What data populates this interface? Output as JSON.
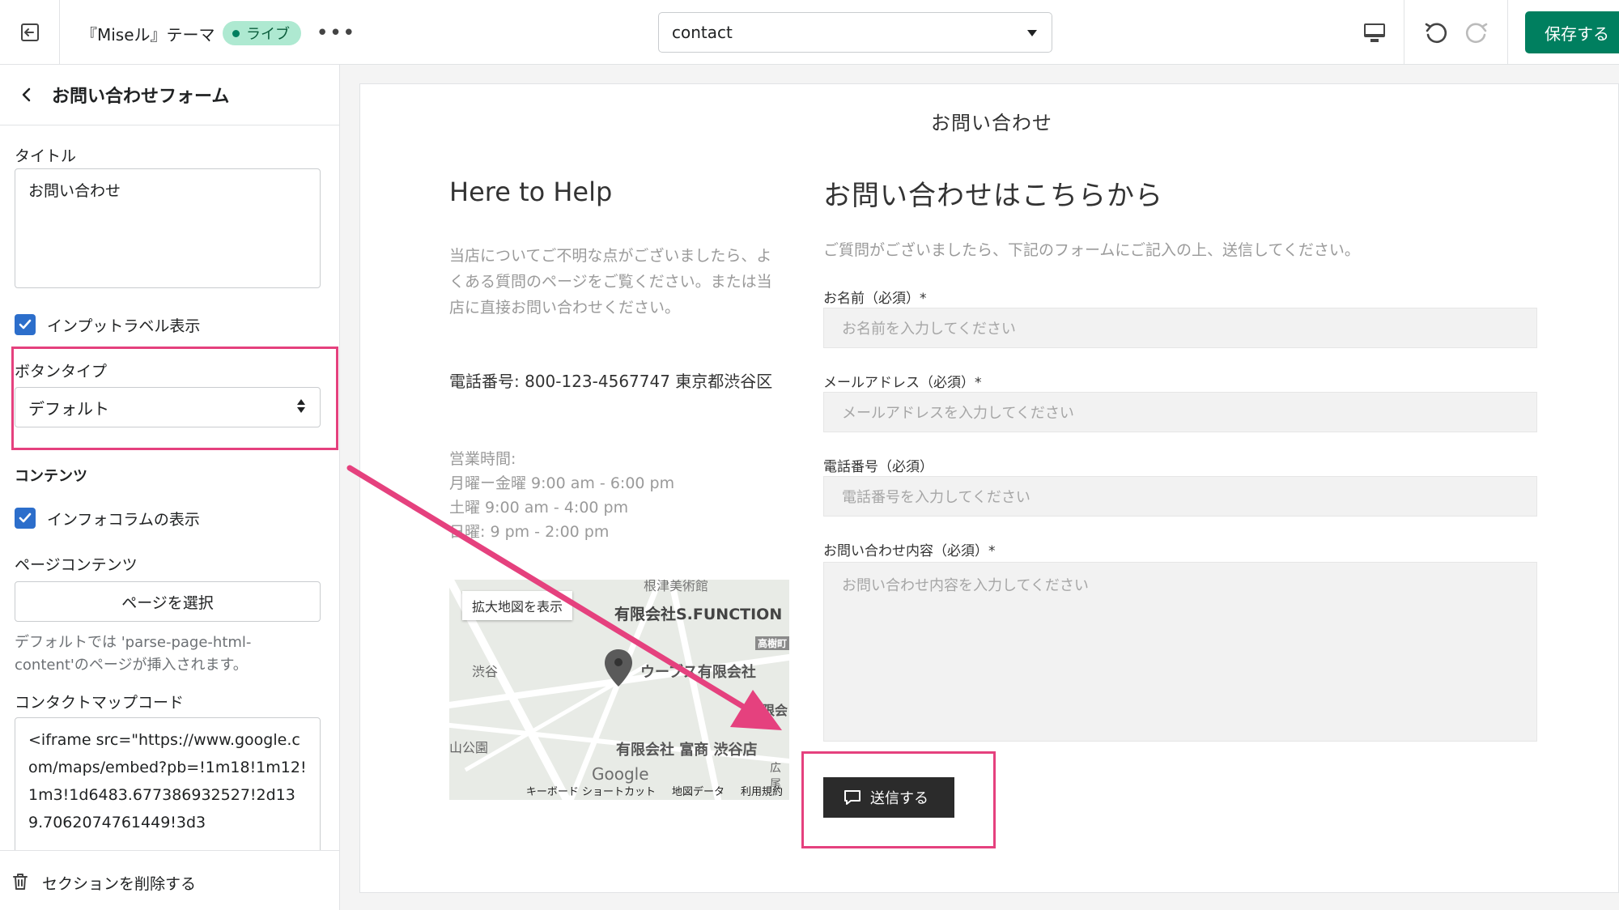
{
  "topbar": {
    "theme_name": "『Miseル』テーマ",
    "live_badge": "ライブ",
    "page_select_value": "contact",
    "save_label": "保存する"
  },
  "sidebar": {
    "title": "お問い合わせフォーム",
    "title_label": "タイトル",
    "title_value": "お問い合わせ",
    "show_input_label": "インプットラベル表示",
    "button_type_label": "ボタンタイプ",
    "button_type_value": "デフォルト",
    "content_heading": "コンテンツ",
    "show_info_column": "インフォコラムの表示",
    "page_content_label": "ページコンテンツ",
    "select_page": "ページを選択",
    "help_text": "デフォルトでは 'parse-page-html-content'のページが挿入されます。",
    "map_code_label": "コンタクトマップコード",
    "map_code_value": "<iframe src=\"https://www.google.com/maps/embed?pb=!1m18!1m12!1m3!1d6483.677386932527!2d139.7062074761449!3d3",
    "delete_section": "セクションを削除する"
  },
  "preview": {
    "page_heading": "お問い合わせ",
    "info": {
      "title": "Here to Help",
      "description": "当店についてご不明な点がございましたら、よくある質問のページをご覧ください。または当店に直接お問い合わせください。",
      "phone": "電話番号: 800-123-4567747 東京都渋谷区",
      "hours_title": "営業時間:",
      "hours": [
        "月曜ー金曜 9:00 am - 6:00 pm",
        "土曜 9:00 am - 4:00 pm",
        "日曜: 9 pm - 2:00 pm"
      ]
    },
    "map": {
      "enlarge": "拡大地図を表示",
      "places": [
        "有限会社S.FUNCTION",
        "ウーブス有限会社",
        "有限会社 富商 渋谷店",
        "根津美術館",
        "渋谷",
        "山公園",
        "高樹町",
        "有限会",
        "広尾"
      ],
      "logo": "Google",
      "footer": [
        "キーボード ショートカット",
        "地図データ",
        "利用規約"
      ]
    },
    "form": {
      "title": "お問い合わせはこちらから",
      "description": "ご質問がございましたら、下記のフォームにご記入の上、送信してください。",
      "name_label": "お名前（必須）*",
      "name_placeholder": "お名前を入力してください",
      "email_label": "メールアドレス（必須）*",
      "email_placeholder": "メールアドレスを入力してください",
      "phone_label": "電話番号（必須）",
      "phone_placeholder": "電話番号を入力してください",
      "message_label": "お問い合わせ内容（必須）*",
      "message_placeholder": "お問い合わせ内容を入力してください",
      "submit": "送信する"
    }
  },
  "colors": {
    "save_button": "#007f5f",
    "live_badge": "#aee9d1",
    "checkbox": "#2c6ecb",
    "highlight": "#e5417e",
    "submit_button": "#2b2b2b"
  },
  "icons": [
    "exit-icon",
    "more-icon",
    "desktop-icon",
    "undo-icon",
    "redo-icon",
    "back-icon",
    "checkmark-icon",
    "trash-icon",
    "chat-icon",
    "map-pin-icon"
  ]
}
